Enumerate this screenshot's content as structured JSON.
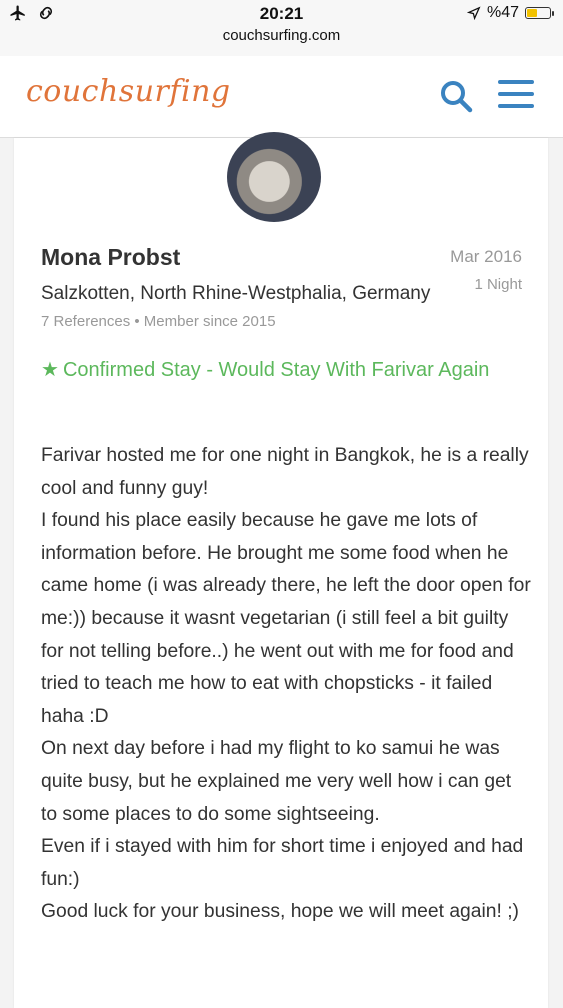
{
  "status_bar": {
    "time": "20:21",
    "url": "couchsurfing.com",
    "battery": "%47",
    "battery_level": 0.47,
    "icons": [
      "airplane-icon",
      "link-icon",
      "location-arrow-icon",
      "battery-icon"
    ]
  },
  "app": {
    "logo": "couchsurfing",
    "brand_color": "#e0743a",
    "accent_color": "#3a83c0"
  },
  "reference": {
    "name": "Mona Probst",
    "location": "Salzkotten, North Rhine-Westphalia, Germany",
    "meta": "7 References • Member since 2015",
    "date": "Mar 2016",
    "duration": "1 Night",
    "confirmed": "Confirmed Stay - Would Stay With Farivar Again",
    "confirmed_color": "#5cb85c",
    "review_lines": [
      "Farivar hosted me for one night in Bangkok, he is a really cool and funny guy!",
      "I found his place easily because he gave me lots of information before. He brought me some food when he came home (i was already there, he left the door open for me:)) because it wasnt vegetarian (i still feel a bit guilty for not telling before..) he went out with me for food and tried to teach me how to eat with chopsticks - it failed haha :D",
      "On next day before i had my flight to ko samui he was quite busy, but he explained me very well how i can get to some places to do some sightseeing.",
      "Even if i stayed with him for short time i enjoyed and had fun:)",
      "Good luck for your business, hope we will meet again! ;)"
    ]
  }
}
